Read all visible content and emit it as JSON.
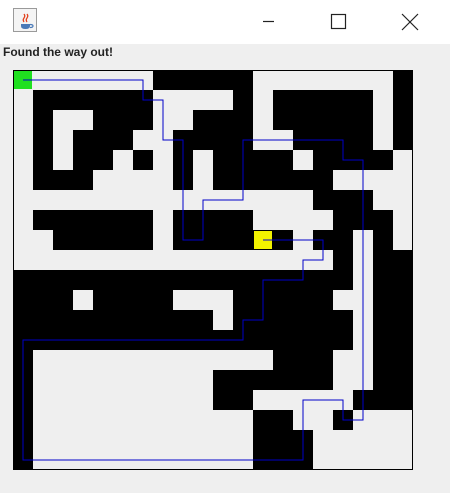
{
  "window": {
    "icon": "java-coffee-cup-icon",
    "controls": [
      "minimize-icon",
      "maximize-icon",
      "close-icon"
    ]
  },
  "status": {
    "message": "Found the way out!"
  },
  "maze": {
    "rows": 20,
    "cols": 20,
    "colors": {
      "wall": "#000000",
      "floor": "#efefef",
      "path": "#0000c8",
      "start": "#20e020",
      "goal": "#f2f200"
    },
    "grid": [
      "00000001111100000001",
      "01111110000101111101",
      "01001110011101111101",
      "01011100111100111101",
      "01011010101111011110",
      "01110000101111110000",
      "00000000000000011100",
      "01111110111100001110",
      "00111110111111011010",
      "00000000000000001011",
      "11111111111111111011",
      "11101111000111110011",
      "11111111110111111011",
      "11111111111111111011",
      "10000000000001110011",
      "10000000001111110011",
      "10000000001100000111",
      "10000000000011001000",
      "10000000000011100000",
      "10000000000011100000"
    ],
    "start_cell": {
      "row": 0,
      "col": 0
    },
    "goal_cell": {
      "row": 8,
      "col": 12
    },
    "solution_path": [
      [
        0,
        0
      ],
      [
        0,
        1
      ],
      [
        0,
        2
      ],
      [
        0,
        3
      ],
      [
        0,
        4
      ],
      [
        0,
        5
      ],
      [
        0,
        6
      ],
      [
        1,
        6
      ],
      [
        1,
        7
      ],
      [
        2,
        7
      ],
      [
        3,
        7
      ],
      [
        3,
        8
      ],
      [
        4,
        8
      ],
      [
        5,
        8
      ],
      [
        6,
        8
      ],
      [
        7,
        8
      ],
      [
        8,
        8
      ],
      [
        8,
        9
      ],
      [
        7,
        9
      ],
      [
        6,
        9
      ],
      [
        6,
        10
      ],
      [
        6,
        11
      ],
      [
        5,
        11
      ],
      [
        4,
        11
      ],
      [
        3,
        11
      ],
      [
        3,
        12
      ],
      [
        3,
        13
      ],
      [
        3,
        14
      ],
      [
        3,
        15
      ],
      [
        3,
        16
      ],
      [
        4,
        16
      ],
      [
        4,
        17
      ],
      [
        5,
        17
      ],
      [
        6,
        17
      ],
      [
        7,
        17
      ],
      [
        8,
        17
      ],
      [
        9,
        17
      ],
      [
        10,
        17
      ],
      [
        11,
        17
      ],
      [
        12,
        17
      ],
      [
        13,
        17
      ],
      [
        14,
        17
      ],
      [
        15,
        17
      ],
      [
        16,
        17
      ],
      [
        17,
        17
      ],
      [
        17,
        16
      ],
      [
        16,
        16
      ],
      [
        16,
        15
      ],
      [
        16,
        14
      ],
      [
        17,
        14
      ],
      [
        18,
        14
      ],
      [
        19,
        14
      ],
      [
        19,
        13
      ],
      [
        19,
        12
      ],
      [
        19,
        11
      ],
      [
        19,
        10
      ],
      [
        19,
        9
      ],
      [
        19,
        8
      ],
      [
        19,
        7
      ],
      [
        19,
        6
      ],
      [
        19,
        5
      ],
      [
        19,
        4
      ],
      [
        19,
        3
      ],
      [
        19,
        2
      ],
      [
        19,
        1
      ],
      [
        19,
        0
      ],
      [
        18,
        0
      ],
      [
        17,
        0
      ],
      [
        16,
        0
      ],
      [
        15,
        0
      ],
      [
        14,
        0
      ],
      [
        13,
        0
      ],
      [
        13,
        1
      ],
      [
        13,
        2
      ],
      [
        13,
        3
      ],
      [
        13,
        4
      ],
      [
        13,
        5
      ],
      [
        13,
        6
      ],
      [
        13,
        7
      ],
      [
        13,
        8
      ],
      [
        13,
        9
      ],
      [
        13,
        10
      ],
      [
        13,
        11
      ],
      [
        12,
        11
      ],
      [
        12,
        12
      ],
      [
        11,
        12
      ],
      [
        10,
        12
      ],
      [
        10,
        13
      ],
      [
        10,
        14
      ],
      [
        9,
        14
      ],
      [
        9,
        15
      ],
      [
        8,
        15
      ],
      [
        8,
        14
      ],
      [
        8,
        13
      ],
      [
        8,
        12
      ]
    ]
  }
}
